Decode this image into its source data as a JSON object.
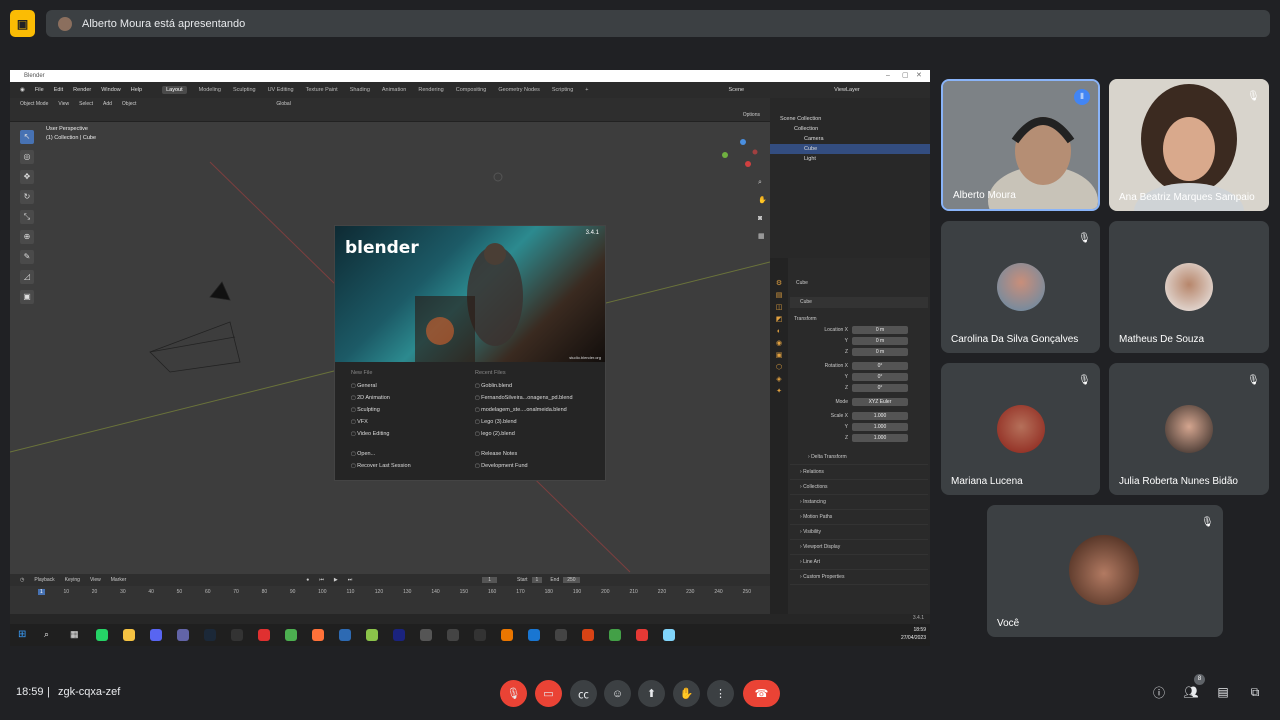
{
  "meet": {
    "presenter_banner": "Alberto Moura está apresentando",
    "clock": "18:59",
    "separator": "|",
    "meeting_code": "zgk-cqxa-zef",
    "people_count": "8"
  },
  "participants": [
    {
      "name": "Alberto Moura",
      "video": true,
      "speaking": true
    },
    {
      "name": "Ana Beatriz Marques Sampaio",
      "video": true,
      "muted": true
    },
    {
      "name": "Carolina Da Silva Gonçalves",
      "muted": true
    },
    {
      "name": "Matheus De Souza",
      "muted": false
    },
    {
      "name": "Mariana Lucena",
      "muted": true
    },
    {
      "name": "Julia Roberta Nunes Bidão",
      "muted": true
    },
    {
      "name": "Você",
      "muted": true
    }
  ],
  "blender": {
    "window_title": "Blender",
    "menu": [
      "File",
      "Edit",
      "Render",
      "Window",
      "Help"
    ],
    "workspaces": [
      "Layout",
      "Modeling",
      "Sculpting",
      "UV Editing",
      "Texture Paint",
      "Shading",
      "Animation",
      "Rendering",
      "Compositing",
      "Geometry Nodes",
      "Scripting"
    ],
    "active_workspace": "Layout",
    "scene": "Scene",
    "view_layer": "ViewLayer",
    "header": [
      "Object Mode",
      "View",
      "Select",
      "Add",
      "Object"
    ],
    "transform_orient": "Global",
    "options": "Options",
    "viewport_info": [
      "User Perspective",
      "(1) Collection | Cube"
    ],
    "splash": {
      "version": "3.4.1",
      "logo": "blender",
      "credit": "studio.blender.org",
      "new_file_head": "New File",
      "new_file": [
        "General",
        "2D Animation",
        "Sculpting",
        "VFX",
        "Video Editing"
      ],
      "recent_head": "Recent Files",
      "recent": [
        "Goblin.blend",
        "FernandoSilveira...onagens_pd.blend",
        "modelagem_ste....onalmeida.blend",
        "Lego (3).blend",
        "lego (2).blend"
      ],
      "open": "Open...",
      "recover": "Recover Last Session",
      "release_notes": "Release Notes",
      "dev_fund": "Development Fund"
    },
    "outliner": {
      "rows": [
        "Scene Collection",
        "Collection",
        "Camera",
        "Cube",
        "Light"
      ]
    },
    "properties": {
      "object": "Cube",
      "object2": "Cube",
      "transform": "Transform",
      "fields": [
        {
          "label": "Location X",
          "value": "0 m"
        },
        {
          "label": "Y",
          "value": "0 m"
        },
        {
          "label": "Z",
          "value": "0 m"
        },
        {
          "label": "Rotation X",
          "value": "0°"
        },
        {
          "label": "Y",
          "value": "0°"
        },
        {
          "label": "Z",
          "value": "0°"
        },
        {
          "label": "Mode",
          "value": "XYZ Euler"
        },
        {
          "label": "Scale X",
          "value": "1.000"
        },
        {
          "label": "Y",
          "value": "1.000"
        },
        {
          "label": "Z",
          "value": "1.000"
        }
      ],
      "panels": [
        "Delta Transform",
        "Relations",
        "Collections",
        "Instancing",
        "Motion Paths",
        "Visibility",
        "Viewport Display",
        "Line Art",
        "Custom Properties"
      ]
    },
    "timeline": {
      "menu": [
        "Playback",
        "Keying",
        "View",
        "Marker"
      ],
      "current_frame": "1",
      "start_label": "Start",
      "start": "1",
      "end_label": "End",
      "end": "250",
      "ticks": [
        "1",
        "10",
        "20",
        "30",
        "40",
        "50",
        "60",
        "70",
        "80",
        "90",
        "100",
        "110",
        "120",
        "130",
        "140",
        "150",
        "160",
        "170",
        "180",
        "190",
        "200",
        "210",
        "220",
        "230",
        "240",
        "250"
      ]
    },
    "version_status": "3.4.1",
    "taskbar_time": "18:59",
    "taskbar_date": "27/04/2023"
  }
}
